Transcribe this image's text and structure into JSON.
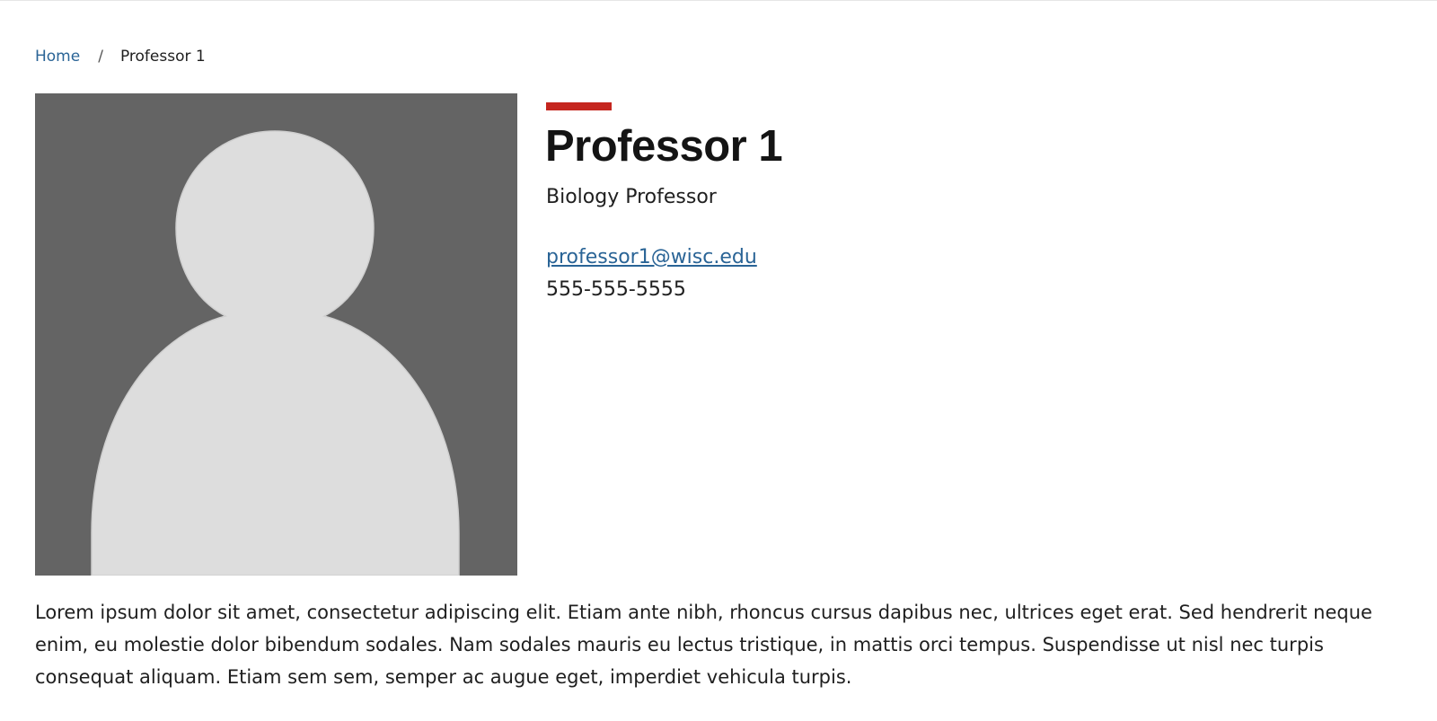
{
  "breadcrumb": {
    "home_label": "Home",
    "separator": "/",
    "current_label": "Professor 1"
  },
  "profile": {
    "name": "Professor 1",
    "title": "Biology Professor",
    "email": "professor1@wisc.edu",
    "phone": "555-555-5555",
    "photo_icon": "person-silhouette-icon",
    "bio": "Lorem ipsum dolor sit amet, consectetur adipiscing elit. Etiam ante nibh, rhoncus cursus dapibus nec, ultrices eget erat. Sed hendrerit neque enim, eu molestie dolor bibendum sodales. Nam sodales mauris eu lectus tristique, in mattis orci tempus. Suspendisse ut nisl nec turpis consequat aliquam. Etiam sem sem, semper ac augue eget, imperdiet vehicula turpis."
  },
  "colors": {
    "accent": "#c5261f",
    "link": "#2a6496",
    "photo_background": "#646464",
    "silhouette": "#dddddd"
  }
}
